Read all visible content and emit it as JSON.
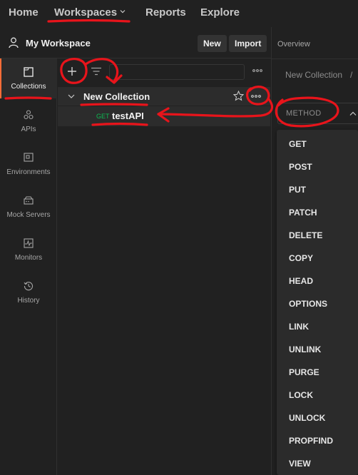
{
  "topnav": {
    "items": [
      "Home",
      "Workspaces",
      "Reports",
      "Explore"
    ]
  },
  "workspace": {
    "title": "My Workspace",
    "new_label": "New",
    "import_label": "Import"
  },
  "sidebar": {
    "items": [
      {
        "label": "Collections",
        "icon": "collections-icon",
        "active": true
      },
      {
        "label": "APIs",
        "icon": "apis-icon"
      },
      {
        "label": "Environments",
        "icon": "environments-icon"
      },
      {
        "label": "Mock Servers",
        "icon": "mock-servers-icon"
      },
      {
        "label": "Monitors",
        "icon": "monitors-icon"
      },
      {
        "label": "History",
        "icon": "history-icon"
      }
    ]
  },
  "collections": {
    "collection_name": "New Collection",
    "request": {
      "method": "GET",
      "name": "testAPI"
    }
  },
  "right": {
    "tab": "Overview",
    "breadcrumb": "New Collection",
    "breadcrumb_sep": "/",
    "method_placeholder": "METHOD"
  },
  "dropdown": {
    "items": [
      "GET",
      "POST",
      "PUT",
      "PATCH",
      "DELETE",
      "COPY",
      "HEAD",
      "OPTIONS",
      "LINK",
      "UNLINK",
      "PURGE",
      "LOCK",
      "UNLOCK",
      "PROPFIND",
      "VIEW"
    ]
  },
  "colors": {
    "accent": "#ff6c37",
    "get_method": "#0cbb52",
    "annotation": "#e8141b"
  }
}
